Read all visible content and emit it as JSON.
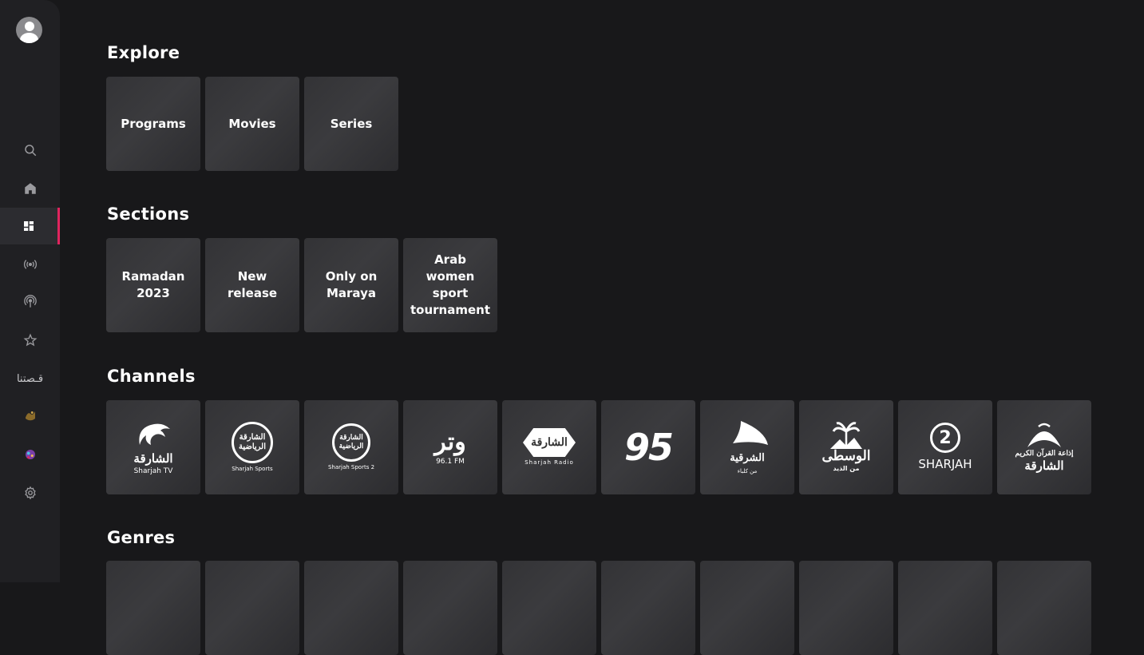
{
  "sidebar": {
    "items": [
      {
        "name": "search",
        "icon": "search-icon"
      },
      {
        "name": "home",
        "icon": "home-icon"
      },
      {
        "name": "categories",
        "icon": "grid-icon",
        "active": true
      },
      {
        "name": "live",
        "icon": "broadcast-icon"
      },
      {
        "name": "podcast",
        "icon": "podcast-icon"
      },
      {
        "name": "favorites",
        "icon": "star-icon"
      },
      {
        "name": "qissatuna",
        "icon": "arabic-logo-icon",
        "text": "قـصتنا"
      },
      {
        "name": "ramadan",
        "icon": "ramadan-logo-icon"
      },
      {
        "name": "kids",
        "icon": "kids-character-icon"
      },
      {
        "name": "settings",
        "icon": "gear-icon"
      }
    ],
    "accent_color": "#e0245e"
  },
  "explore": {
    "title": "Explore",
    "items": [
      "Programs",
      "Movies",
      "Series"
    ]
  },
  "sections": {
    "title": "Sections",
    "items": [
      "Ramadan 2023",
      "New release",
      "Only on Maraya",
      "Arab women sport tournament"
    ]
  },
  "channels": {
    "title": "Channels",
    "items": [
      {
        "logo": "sharjah-tv-logo",
        "ar": "الشارقة",
        "caption": "Sharjah TV"
      },
      {
        "logo": "sharjah-sports-logo",
        "ar": "الشارقة الرياضية",
        "caption": "Sharjah Sports"
      },
      {
        "logo": "sharjah-sports-2-logo",
        "ar": "الشارقة الرياضية",
        "caption": "Sharjah Sports 2"
      },
      {
        "logo": "watar-radio-logo",
        "ar": "وتر",
        "caption": "96.1 FM"
      },
      {
        "logo": "sharjah-radio-logo",
        "ar": "الشارقة",
        "caption": "Sharjah Radio"
      },
      {
        "logo": "pulse-95-logo",
        "ar": "",
        "caption": "95"
      },
      {
        "logo": "alsharqiya-logo",
        "ar": "الشرقية",
        "caption": "من كلباء"
      },
      {
        "logo": "alwusta-logo",
        "ar": "الوسطى",
        "caption": "من الذيد"
      },
      {
        "logo": "sharjah-2-logo",
        "ar": "2",
        "caption": "SHARJAH"
      },
      {
        "logo": "quran-radio-logo",
        "ar": "إذاعة القرآن الكريم",
        "caption": "الشارقة"
      }
    ]
  },
  "genres": {
    "title": "Genres",
    "count": 10
  }
}
